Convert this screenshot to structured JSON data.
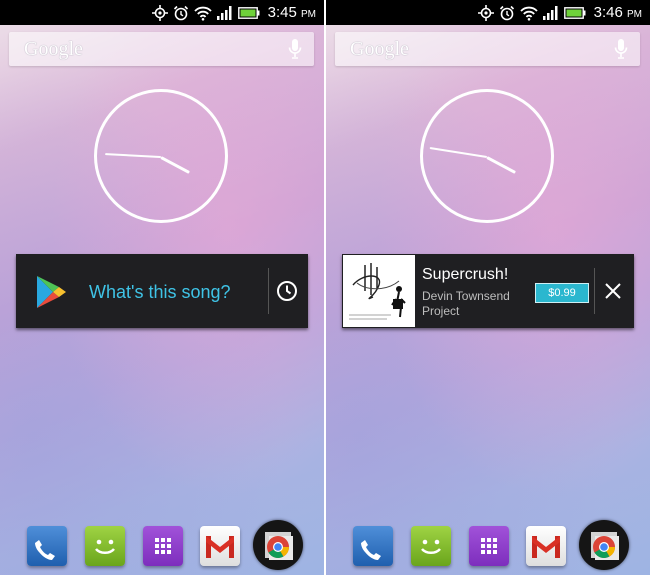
{
  "screens": [
    {
      "status": {
        "time": "3:45",
        "ampm": "PM"
      },
      "search": {
        "logo": "Google"
      },
      "card": {
        "prompt": "What's this song?"
      }
    },
    {
      "status": {
        "time": "3:46",
        "ampm": "PM"
      },
      "search": {
        "logo": "Google"
      },
      "card": {
        "title": "Supercrush!",
        "artist": "Devin Townsend Project",
        "price": "$0.99"
      }
    }
  ],
  "dock": [
    "phone-icon",
    "messages-icon",
    "all-apps-icon",
    "gmail-icon",
    "chrome-icon"
  ],
  "colors": {
    "accent": "#3fc3e6",
    "price_bg": "#2bb7cf",
    "card_bg": "#1f1f22"
  }
}
